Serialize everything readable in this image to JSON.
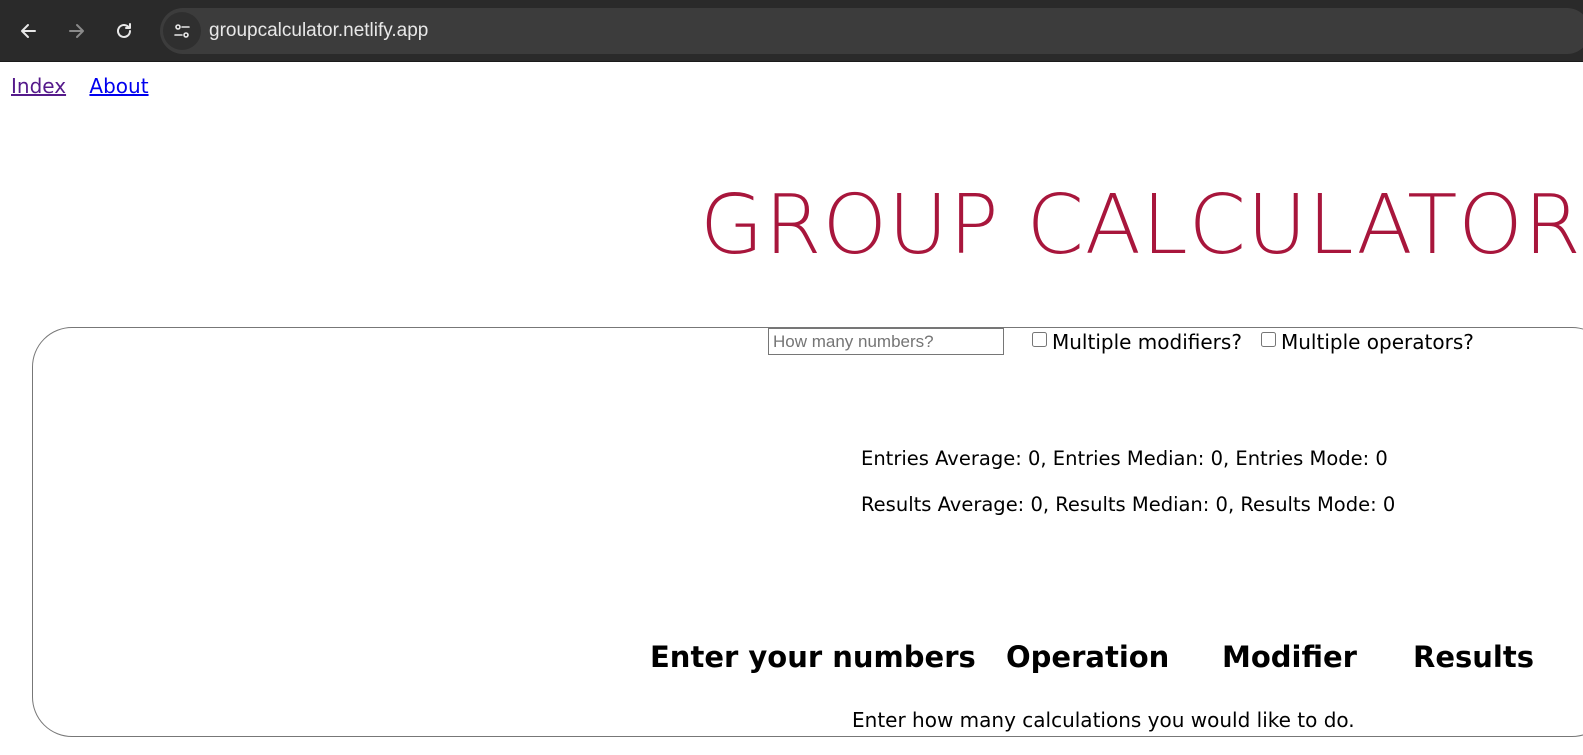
{
  "browser": {
    "url": "groupcalculator.netlify.app",
    "icons": [
      "back-arrow-icon",
      "forward-arrow-icon",
      "reload-icon",
      "site-settings-icon"
    ]
  },
  "nav": {
    "index_label": "Index",
    "about_label": "About"
  },
  "page": {
    "title": "GROUP CALCULATOR",
    "count_input": {
      "placeholder": "How many numbers?",
      "value": ""
    },
    "multiple_modifiers_label": "Multiple modifiers?",
    "multiple_operators_label": "Multiple operators?",
    "entries_stats": "Entries Average: 0, Entries Median: 0, Entries Mode: 0",
    "results_stats": "Results Average: 0, Results Median: 0, Results Mode: 0",
    "columns": [
      "Enter your numbers",
      "Operation",
      "Modifier",
      "Results"
    ],
    "instruction": "Enter how many calculations you would like to do."
  },
  "colors": {
    "title": "#a8163c",
    "chrome_bg": "#2a2a2a",
    "omnibox_bg": "#3c3c3c",
    "visited_link": "#551a8b",
    "link": "#0000ee"
  }
}
